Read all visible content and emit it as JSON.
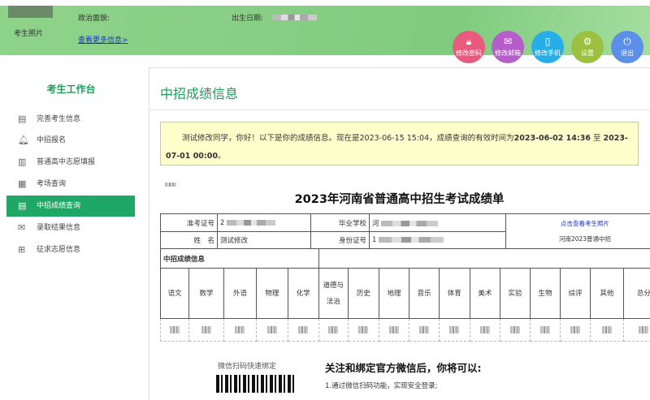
{
  "header": {
    "photo_label": "考生照片",
    "political_label": "政治面貌:",
    "birth_label": "出生日期:",
    "more_link": "查看更多信息>",
    "actions": [
      {
        "label": "修改密码",
        "icon": "lock-icon",
        "color": "#e95a7f"
      },
      {
        "label": "修改邮箱",
        "icon": "mail-icon",
        "color": "#b55ec9"
      },
      {
        "label": "修改手机",
        "icon": "phone-icon",
        "color": "#27aee8"
      },
      {
        "label": "设置",
        "icon": "gear-icon",
        "color": "#9cc03f"
      },
      {
        "label": "退出",
        "icon": "power-icon",
        "color": "#5b8fe8"
      }
    ]
  },
  "sidebar": {
    "title": "考生工作台",
    "items": [
      {
        "label": "完善考生信息",
        "icon": "id-card-icon"
      },
      {
        "label": "中招报名",
        "icon": "bell-icon"
      },
      {
        "label": "普通高中志愿填报",
        "icon": "building-icon"
      },
      {
        "label": "考场查询",
        "icon": "grid-icon"
      },
      {
        "label": "中招成绩查询",
        "icon": "document-icon",
        "active": true
      },
      {
        "label": "录取结果信息",
        "icon": "envelope-icon"
      },
      {
        "label": "征求志愿信息",
        "icon": "form-add-icon"
      }
    ]
  },
  "main": {
    "title": "中招成绩信息",
    "notice": {
      "text": "测试修改同学，你好！以下是你的成绩信息。现在是2023-06-15 15:04，成绩查询的有效时间为",
      "start": "2023-06-02 14:36",
      "to": " 至 ",
      "end": "2023-07-01 00:00",
      "tail": "。"
    },
    "report_title": "2023年河南省普通高中招生考试成绩单",
    "info": {
      "ticket_label": "准考证号",
      "ticket_value": "2",
      "school_label": "毕业学校",
      "school_value": "河",
      "name_label": "姓　名",
      "name_value": "测试修改",
      "id_label": "身份证号",
      "id_value": "1",
      "photo_link": "点击查看考生照片",
      "photo_caption": "河南2023普通中招"
    },
    "score_section": "中招成绩信息",
    "subjects": [
      "语文",
      "数学",
      "外语",
      "物理",
      "化学",
      "道德与法治",
      "历史",
      "地理",
      "音乐",
      "体育",
      "美术",
      "实验",
      "生物",
      "综评",
      "其他",
      "总分"
    ],
    "wechat": {
      "scan_label": "微信扫码快速绑定",
      "heading": "关注和绑定官方微信后，你将可以:",
      "items": [
        "1.通过微信扫码功能，实现安全登录;"
      ]
    }
  },
  "colors": {
    "accent": "#1ea765",
    "header_green": "#86cf84",
    "notice_bg": "#ffffcc",
    "link": "#2233cc"
  }
}
